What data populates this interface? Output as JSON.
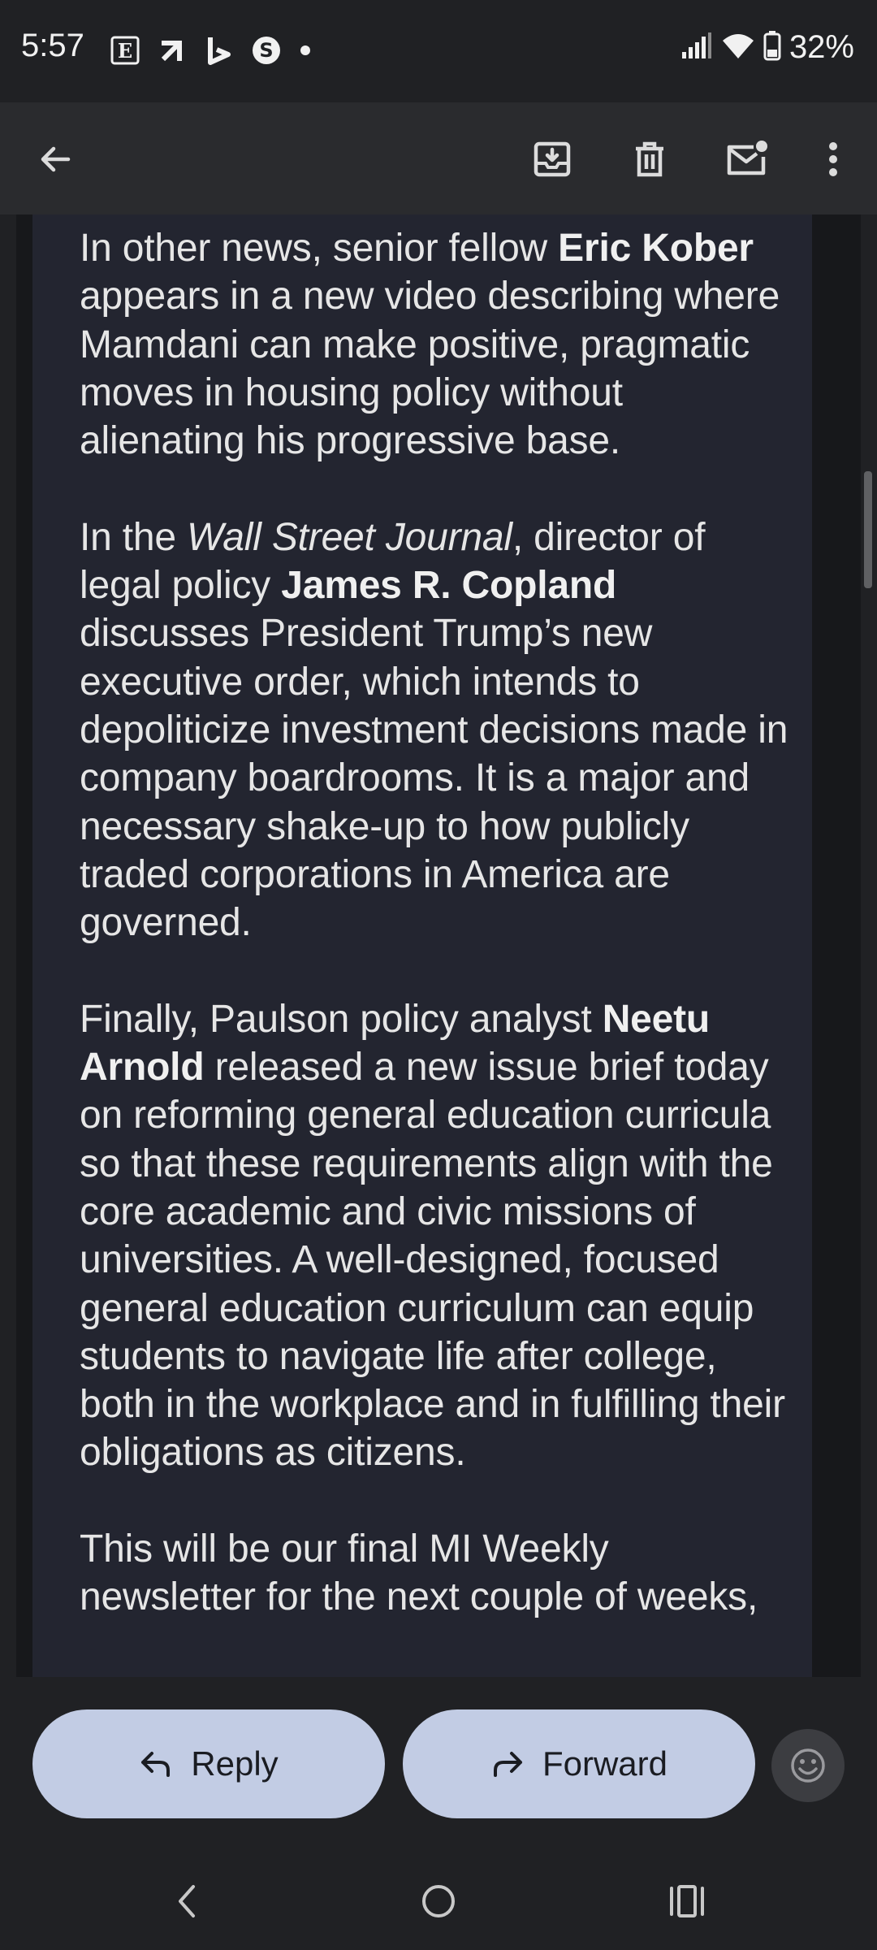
{
  "status_bar": {
    "time": "5:57",
    "battery": "32%",
    "left_icons": [
      "e-app-icon",
      "arrow-app-icon",
      "b-app-icon",
      "s-app-icon"
    ],
    "right_icons": [
      "signal-icon",
      "wifi-icon",
      "battery-icon"
    ]
  },
  "toolbar": {
    "back_icon": "arrow-left-icon",
    "actions": [
      "archive-icon",
      "delete-icon",
      "mark-unread-icon",
      "more-vert-icon"
    ]
  },
  "email": {
    "p1": {
      "pre": "In other news, senior fellow ",
      "name": "Eric Kober",
      "post": " appears in a new video describing where Mamdani can make positive, pragmatic moves in housing policy without alienating his progressive base."
    },
    "p2": {
      "pre": "In the ",
      "publication": "Wall Street Journal",
      "mid": ", director of legal policy ",
      "name": "James R. Copland",
      "post": " discusses President Trump’s new executive order, which intends to depoliticize investment decisions made in company boardrooms. It is a major and necessary shake-up to how publicly traded corporations in America are governed."
    },
    "p3": {
      "pre": "Finally, Paulson policy analyst ",
      "name": "Neetu Arnold",
      "post": " released a new issue brief today on reforming general education curricula so that these requirements align with the core academic and civic missions of universities. A well-designed, focused general education curriculum can equip students to navigate life after college, both in the workplace and in fulfilling their obligations as citizens."
    },
    "p4": {
      "text": "This will be our final MI Weekly newsletter for the next couple of weeks,"
    }
  },
  "actions": {
    "reply_label": "Reply",
    "forward_label": "Forward",
    "reply_icon": "reply-icon",
    "forward_icon": "forward-icon",
    "emoji_icon": "emoji-icon"
  },
  "colors": {
    "background": "#202124",
    "toolbar": "#2a2b2e",
    "card": "#232530",
    "button": "#c2cce4",
    "text": "#e6e6e6"
  }
}
